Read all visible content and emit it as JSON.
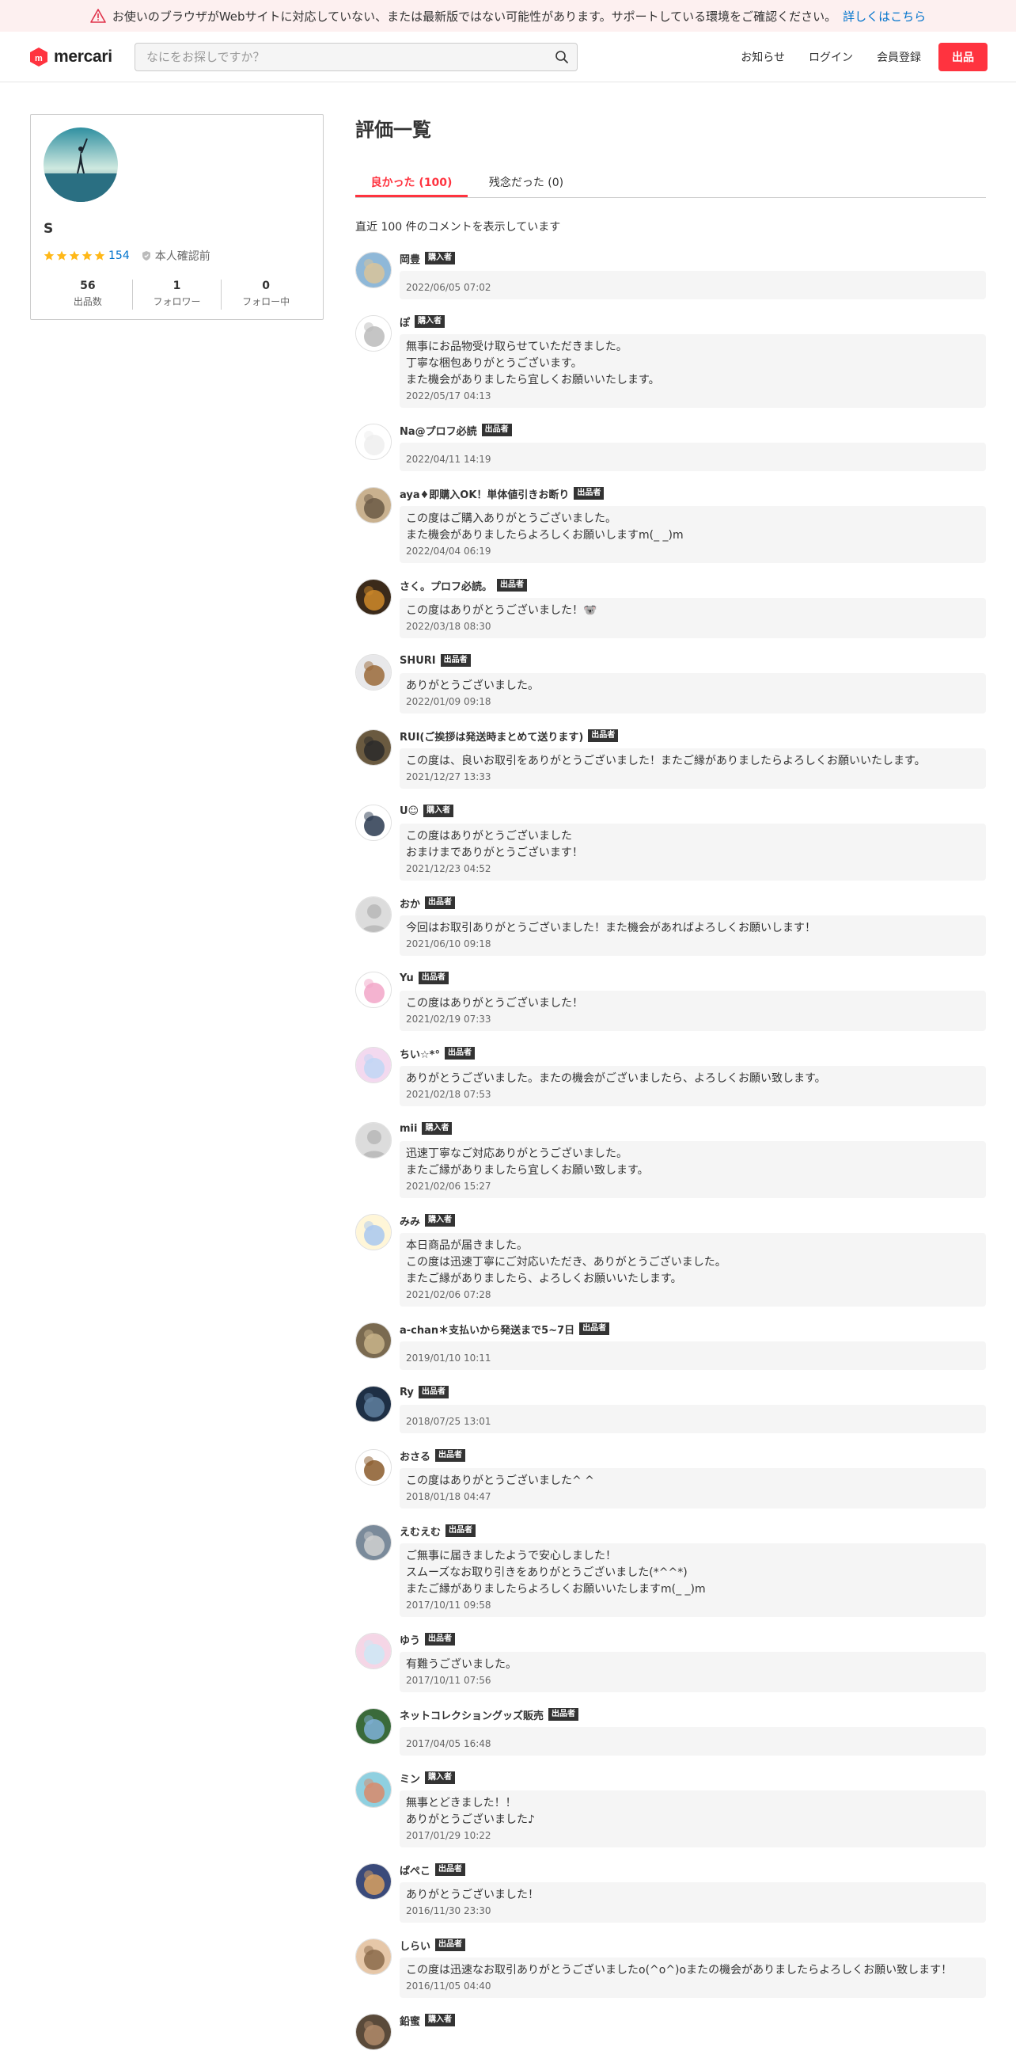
{
  "banner": {
    "message": "お使いのブラウザがWebサイトに対応していない、または最新版ではない可能性があります。サポートしている環境をご確認ください。",
    "link": "詳しくはこちら"
  },
  "header": {
    "logo": "mercari",
    "search_placeholder": "なにをお探しですか？",
    "nav": {
      "news": "お知らせ",
      "login": "ログイン",
      "signup": "会員登録",
      "sell": "出品"
    }
  },
  "profile": {
    "name": "S",
    "rating_stars": 5,
    "rating_count": "154",
    "verification": "本人確認前",
    "stats": [
      {
        "num": "56",
        "label": "出品数"
      },
      {
        "num": "1",
        "label": "フォロワー"
      },
      {
        "num": "0",
        "label": "フォロー中"
      }
    ]
  },
  "page": {
    "title": "評価一覧",
    "tab_good": "良かった (100)",
    "tab_bad": "残念だった (0)",
    "note": "直近 100 件のコメントを表示しています"
  },
  "colors": {
    "accent": "#ff333f",
    "link": "#0073cc",
    "star": "#ffb818"
  },
  "reviews": [
    {
      "user": "岡豊",
      "badge": "購入者",
      "comment": "",
      "date": "2022/06/05 07:02"
    },
    {
      "user": "ぽ",
      "badge": "購入者",
      "comment": "無事にお品物受け取らせていただきました。\n丁寧な梱包ありがとうございます。\nまた機会がありましたら宜しくお願いいたします。",
      "date": "2022/05/17 04:13"
    },
    {
      "user": "Na@プロフ必読",
      "badge": "出品者",
      "comment": "",
      "date": "2022/04/11 14:19"
    },
    {
      "user": "aya♦即購入OK！単体値引きお断り",
      "badge": "出品者",
      "comment": "この度はご購入ありがとうございました。\nまた機会がありましたらよろしくお願いしますm(_ _)m",
      "date": "2022/04/04 06:19"
    },
    {
      "user": "さく。プロフ必読。",
      "badge": "出品者",
      "comment": "この度はありがとうございました！🐨",
      "date": "2022/03/18 08:30"
    },
    {
      "user": "SHURI",
      "badge": "出品者",
      "comment": "ありがとうございました。",
      "date": "2022/01/09 09:18"
    },
    {
      "user": "RUI(ご挨拶は発送時まとめて送ります)",
      "badge": "出品者",
      "comment": "この度は、良いお取引をありがとうございました！またご縁がありましたらよろしくお願いいたします。",
      "date": "2021/12/27 13:33"
    },
    {
      "user": "U☺",
      "badge": "購入者",
      "comment": "この度はありがとうございました\nおまけまでありがとうございます！",
      "date": "2021/12/23 04:52"
    },
    {
      "user": "おか",
      "badge": "出品者",
      "comment": "今回はお取引ありがとうございました！また機会があればよろしくお願いします！",
      "date": "2021/06/10 09:18"
    },
    {
      "user": "Yu",
      "badge": "出品者",
      "comment": "この度はありがとうございました！",
      "date": "2021/02/19 07:33"
    },
    {
      "user": "ちい☆*°",
      "badge": "出品者",
      "comment": "ありがとうございました。またの機会がございましたら、よろしくお願い致します。",
      "date": "2021/02/18 07:53"
    },
    {
      "user": "mii",
      "badge": "購入者",
      "comment": "迅速丁寧なご対応ありがとうございました。\nまたご縁がありましたら宜しくお願い致します。",
      "date": "2021/02/06 15:27"
    },
    {
      "user": "みみ",
      "badge": "購入者",
      "comment": "本日商品が届きました。\nこの度は迅速丁寧にご対応いただき、ありがとうございました。\nまたご縁がありましたら、よろしくお願いいたします。",
      "date": "2021/02/06 07:28"
    },
    {
      "user": "a-chan＊支払いから発送まで5~7日",
      "badge": "出品者",
      "comment": "",
      "date": "2019/01/10 10:11"
    },
    {
      "user": "Ry",
      "badge": "出品者",
      "comment": "",
      "date": "2018/07/25 13:01"
    },
    {
      "user": "おさる",
      "badge": "出品者",
      "comment": "この度はありがとうございました^ ^",
      "date": "2018/01/18 04:47"
    },
    {
      "user": "えむえむ",
      "badge": "出品者",
      "comment": "ご無事に届きましたようで安心しました！\nスムーズなお取り引きをありがとうございました(*^^*)\nまたご縁がありましたらよろしくお願いいたしますm(_ _)m",
      "date": "2017/10/11 09:58"
    },
    {
      "user": "ゆう",
      "badge": "出品者",
      "comment": "有難うございました。",
      "date": "2017/10/11 07:56"
    },
    {
      "user": "ネットコレクショングッズ販売",
      "badge": "出品者",
      "comment": "",
      "date": "2017/04/05 16:48"
    },
    {
      "user": "ミン",
      "badge": "購入者",
      "comment": "無事とどきました！！\nありがとうございました♪",
      "date": "2017/01/29 10:22"
    },
    {
      "user": "ぱぺこ",
      "badge": "出品者",
      "comment": "ありがとうございました！",
      "date": "2016/11/30 23:30"
    },
    {
      "user": "しらい",
      "badge": "出品者",
      "comment": "この度は迅速なお取引ありがとうございましたo(^o^)oまたの機会がありましたらよろしくお願い致します！",
      "date": "2016/11/05 04:40"
    },
    {
      "user": "鉛蜜",
      "badge": "購入者",
      "comment": "",
      "date": ""
    }
  ]
}
